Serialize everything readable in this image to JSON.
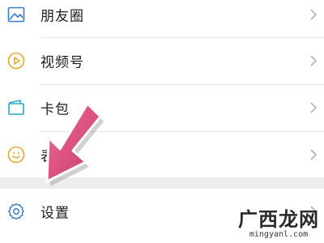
{
  "menu": {
    "items": [
      {
        "label": "朋友圈",
        "icon": "moments-icon"
      },
      {
        "label": "视频号",
        "icon": "channels-icon"
      },
      {
        "label": "卡包",
        "icon": "card-wallet-icon"
      },
      {
        "label": "表情",
        "icon": "sticker-icon"
      },
      {
        "label": "设置",
        "icon": "gear-icon"
      }
    ]
  },
  "watermark": {
    "brand": "广西龙网",
    "url": "mingyanl.com"
  },
  "colors": {
    "icon_blue": "#3a79c5",
    "icon_yellow": "#e5a82a",
    "icon_teal": "#2aa7c6",
    "arrow_pink": "#e0507f",
    "chevron": "#b2b2b2"
  }
}
